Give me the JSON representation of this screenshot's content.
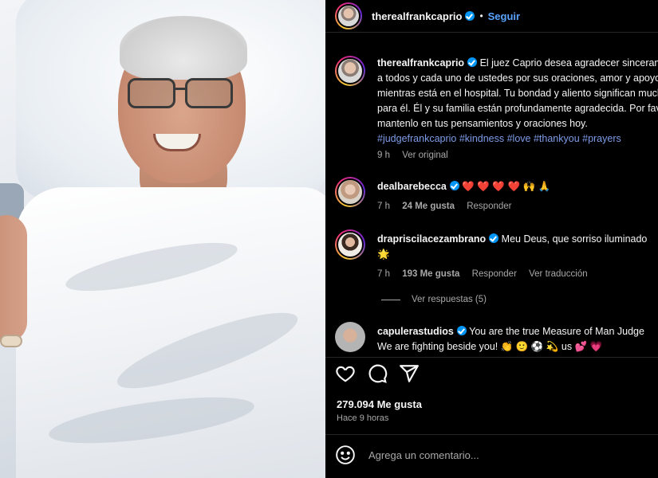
{
  "post": {
    "username": "therealfrankcaprio",
    "separator": "•",
    "follow_label": "Seguir",
    "image_alt": "hospital-photo"
  },
  "caption": {
    "username": "therealfrankcaprio",
    "lines": [
      "El juez Caprio desea agradecer sinceramente",
      "a todos y cada uno de ustedes por sus oraciones, amor y apoyo",
      "mientras está en el hospital. Tu bondad y aliento significan mucho",
      "para él. Él y su familia están profundamente agradecida. Por favor,",
      "mantenlo en tus pensamientos y oraciones hoy."
    ],
    "first_line": "El juez Caprio desea agradecer sinceramente",
    "hashtags": "#judgefrankcaprio #kindness #love #thankyou #prayers",
    "time": "9 h",
    "see_original": "Ver original"
  },
  "comments": [
    {
      "username": "dealbarebecca",
      "text": "❤️ ❤️ ❤️ ❤️ 🙌 🙏",
      "time": "7 h",
      "likes": "24 Me gusta",
      "reply": "Responder"
    },
    {
      "username": "drapriscilacezambrano",
      "text": "Meu Deus, que sorriso iluminado",
      "text2": "🌟",
      "time": "7 h",
      "likes": "193 Me gusta",
      "reply": "Responder",
      "translate": "Ver traducción"
    },
    {
      "username": "capulerastudios",
      "text": "You are the true Measure of Man Judge",
      "text2": "We are fighting beside you! 👏 🙂 ⚽ 💫 us 💕 💗"
    }
  ],
  "view_replies": "Ver respuestas (5)",
  "likes_total": "279.094 Me gusta",
  "posted": "Hace 9 horas",
  "comment_placeholder": "Agrega un comentario...",
  "icons": [
    "heart-icon",
    "comment-icon",
    "share-icon",
    "emoji-icon",
    "verified-icon"
  ],
  "colors": {
    "link": "#5aa3ff",
    "verified": "#0095f6",
    "hashtag": "#7d9ce8",
    "muted": "#a8a8a8"
  }
}
